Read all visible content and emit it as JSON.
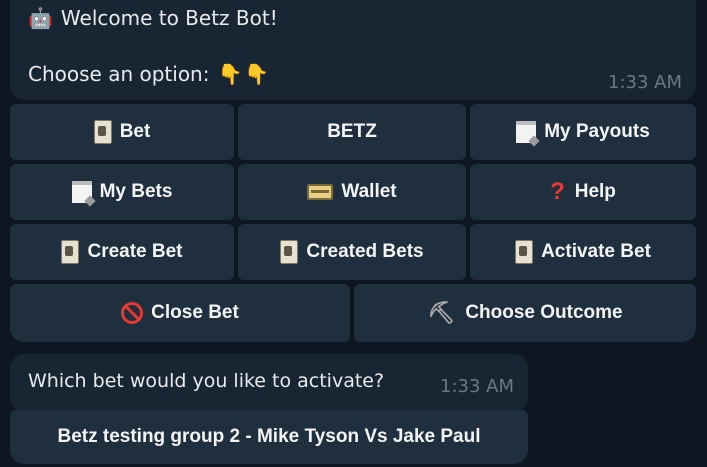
{
  "welcome": {
    "greeting": "Welcome to Betz Bot!",
    "prompt": "Choose an option:",
    "time": "1:33 AM",
    "icons": [
      "robot-icon",
      "pointing-down-hand-icon",
      "pointing-down-hand-icon"
    ]
  },
  "keyboard": {
    "row1": [
      {
        "label": "Bet",
        "icon": "card-icon"
      },
      {
        "label": "BETZ",
        "icon": ""
      },
      {
        "label": "My Payouts",
        "icon": "notepad-icon"
      }
    ],
    "row2": [
      {
        "label": "My Bets",
        "icon": "notepad-icon"
      },
      {
        "label": "Wallet",
        "icon": "credit-card-icon"
      },
      {
        "label": "Help",
        "icon": "red-question-icon"
      }
    ],
    "row3": [
      {
        "label": "Create Bet",
        "icon": "card-icon"
      },
      {
        "label": "Created Bets",
        "icon": "card-icon"
      },
      {
        "label": "Activate Bet",
        "icon": "card-icon"
      }
    ],
    "row4": [
      {
        "label": "Close Bet",
        "icon": "prohibited-icon"
      },
      {
        "label": "Choose Outcome",
        "icon": "pick-icon"
      }
    ]
  },
  "activate_message": {
    "text": "Which bet would you like to activate?",
    "time": "1:33 AM"
  },
  "bet_option": {
    "label": "Betz testing group 2 - Mike Tyson Vs Jake Paul"
  },
  "colors": {
    "background": "#0e1621",
    "bubble": "#182533",
    "button": "#202f3e",
    "timestamp": "#6c7883"
  }
}
